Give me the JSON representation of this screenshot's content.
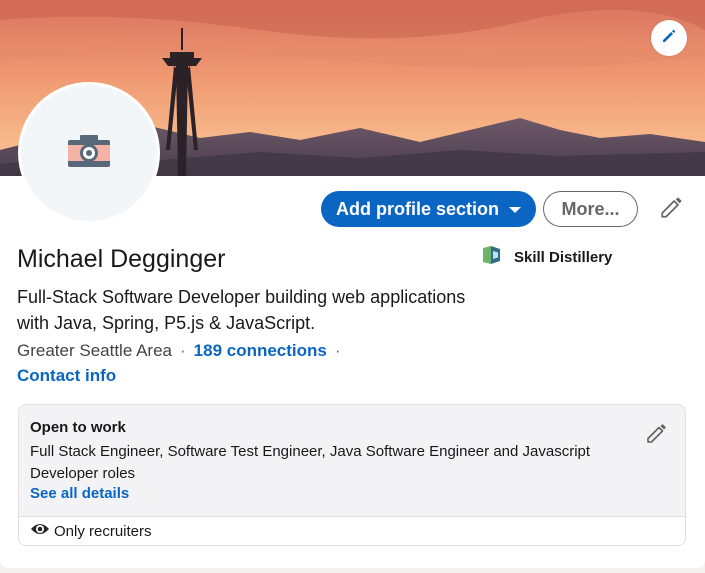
{
  "profile": {
    "name": "Michael Degginger",
    "headline": "Full-Stack Software Developer building web applications with Java, Spring, P5.js & JavaScript.",
    "location": "Greater Seattle Area",
    "connections": "189 connections",
    "contact_info": "Contact info",
    "separator": "·",
    "company": {
      "name": "Skill Distillery",
      "logo_icon": "skill-distillery-logo-icon"
    },
    "avatar_icon": "camera-icon"
  },
  "actions": {
    "add_section_label": "Add profile section",
    "more_label": "More...",
    "edit_icon": "pencil-icon",
    "cover_edit_icon": "pencil-icon"
  },
  "open_to_work": {
    "title": "Open to work",
    "roles": "Full Stack Engineer, Software Test Engineer, Java Software Engineer and Javascript Developer roles",
    "see_details": "See all details",
    "visibility": "Only recruiters",
    "visibility_icon": "eye-icon"
  },
  "colors": {
    "primary": "#0a66c2",
    "cover_sky_top": "#e8836b",
    "cover_mountain": "#5f4e5c"
  }
}
